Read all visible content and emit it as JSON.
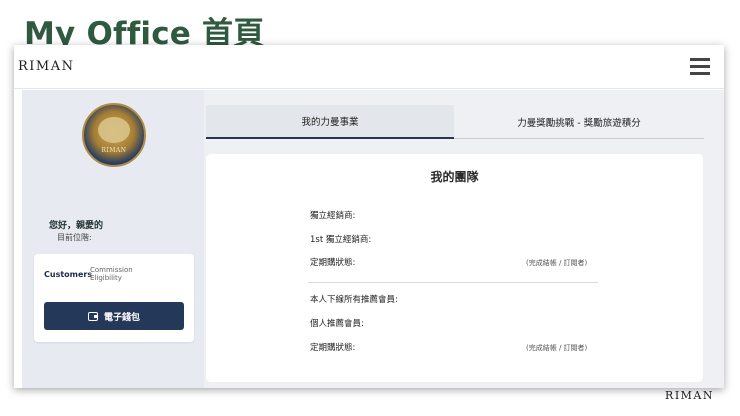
{
  "slide": {
    "title": "My Office 首頁",
    "footer_brand": "RIMAN"
  },
  "header": {
    "brand": "RIMAN",
    "menu_icon": "hamburger-menu-icon"
  },
  "profile": {
    "badge_text": "RIMAN",
    "greeting": "您好，親愛的",
    "position_label": "目前位階:"
  },
  "summary_card": {
    "customers_label": "Customers",
    "commission_label": "Commission Eligibility",
    "wallet_button": "電子錢包",
    "wallet_icon": "wallet-icon"
  },
  "tabs": [
    {
      "label": "我的力曼事業",
      "active": true
    },
    {
      "label": "力曼獎勵挑戰 - 獎勵旅遊積分",
      "active": false
    }
  ],
  "team_panel": {
    "title": "我的團隊",
    "rows": [
      {
        "label": "獨立經銷商:",
        "note": ""
      },
      {
        "label": "1st 獨立經銷商:",
        "note": ""
      },
      {
        "label": "定期購狀態:",
        "note": "(完成結帳 / 訂閱者)"
      },
      {
        "label": "本人下線所有推薦會員:",
        "note": ""
      },
      {
        "label": "個人推薦會員:",
        "note": ""
      },
      {
        "label": "定期購狀態:",
        "note": "(完成結帳 / 訂閱者)"
      }
    ]
  },
  "colors": {
    "title_green": "#2f5a3f",
    "navy": "#24385a",
    "panel_bg": "#eef0f4"
  }
}
